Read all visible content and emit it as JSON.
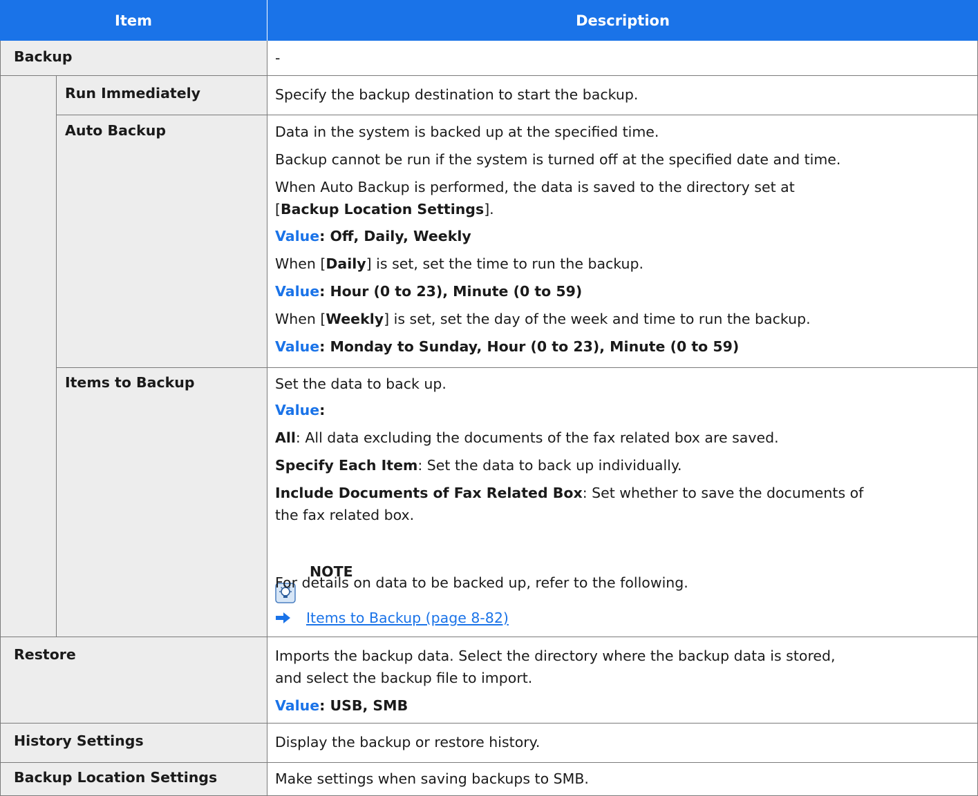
{
  "header": {
    "col_item": "Item",
    "col_description": "Description"
  },
  "rows": {
    "backup": {
      "label": "Backup",
      "desc": "-"
    },
    "run_immediately": {
      "label": "Run Immediately",
      "desc": "Specify the backup destination to start the backup."
    },
    "auto_backup": {
      "label": "Auto Backup",
      "l1": "Data in the system is backed up at the specified time.",
      "l2": "Backup cannot be run if the system is turned off at the specified date and time.",
      "l3": "When Auto Backup is performed, the data is saved to the directory set at",
      "l4_pre": "[",
      "l4_bold": "Backup Location Settings",
      "l4_post": "].",
      "v1_key": "Value",
      "v1_val": ": Off, Daily, Weekly",
      "l5_pre": "When [",
      "l5_bold": "Daily",
      "l5_post": "] is set, set the time to run the backup.",
      "v2_key": "Value",
      "v2_val": ": Hour (0 to 23), Minute (0 to 59)",
      "l6_pre": "When [",
      "l6_bold": "Weekly",
      "l6_post": "] is set, set the day of the week and time to run the backup.",
      "v3_key": "Value",
      "v3_val": ": Monday to Sunday, Hour (0 to 23), Minute (0 to 59)"
    },
    "items_to_backup": {
      "label": "Items to Backup",
      "l1": "Set the data to back up.",
      "v_key": "Value",
      "v_val": ":",
      "all_bold": "All",
      "all_text": ": All data excluding the documents of the fax related box are saved.",
      "each_bold": "Specify Each Item",
      "each_text": ": Set the data to back up individually.",
      "fax_bold": "Include Documents of Fax Related Box",
      "fax_text": ": Set whether to save the documents of",
      "fax_text2": "the fax related box.",
      "note_title": "NOTE",
      "note_text": "For details on data to be backed up, refer to the following.",
      "link_text": "Items to Backup (page 8-82)"
    },
    "restore": {
      "label": "Restore",
      "l1": "Imports the backup data. Select the directory where the backup data is stored,",
      "l2": "and select the backup file to import.",
      "v_key": "Value",
      "v_val": ": USB, SMB"
    },
    "history_settings": {
      "label": "History Settings",
      "desc": "Display the backup or restore history."
    },
    "backup_location_settings": {
      "label": "Backup Location Settings",
      "desc": "Make settings when saving backups to SMB."
    }
  },
  "colors": {
    "header_bg": "#1a73e8",
    "accent": "#1a73e8",
    "cell_gray": "#ededed",
    "border": "#7a7a7a"
  },
  "icons": {
    "note": "lightbulb-note-icon",
    "arrow": "arrow-right-icon"
  }
}
